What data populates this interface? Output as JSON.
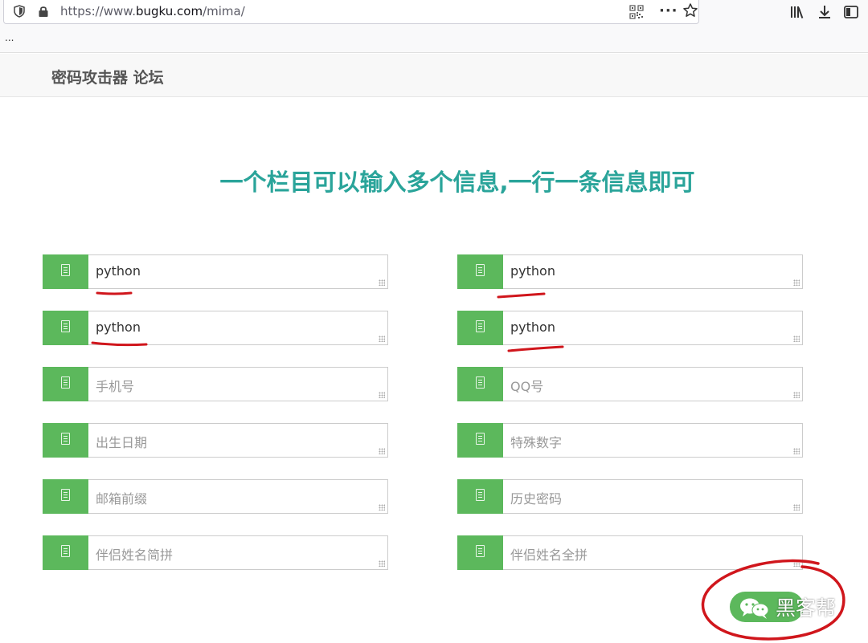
{
  "browser": {
    "url_prefix": "https://www.",
    "url_host": "bugku.com",
    "url_path": "/mima/",
    "more_glyph": "···",
    "bookmarks_overflow": "..."
  },
  "site": {
    "brand": "密码攻击器 论坛"
  },
  "headline": "一个栏目可以输入多个信息,一行一条信息即可",
  "fields": [
    {
      "value": "python",
      "placeholder": ""
    },
    {
      "value": "python",
      "placeholder": ""
    },
    {
      "value": "python",
      "placeholder": ""
    },
    {
      "value": "python",
      "placeholder": ""
    },
    {
      "value": "",
      "placeholder": "手机号"
    },
    {
      "value": "",
      "placeholder": "QQ号"
    },
    {
      "value": "",
      "placeholder": "出生日期"
    },
    {
      "value": "",
      "placeholder": "特殊数字"
    },
    {
      "value": "",
      "placeholder": "邮箱前缀"
    },
    {
      "value": "",
      "placeholder": "历史密码"
    },
    {
      "value": "",
      "placeholder": "伴侣姓名简拼"
    },
    {
      "value": "",
      "placeholder": "伴侣姓名全拼"
    }
  ],
  "watermark": {
    "text": "黑客帮"
  },
  "colors": {
    "accent_green": "#5cb85c",
    "headline_teal": "#2aa49a",
    "annotation_red": "#d0161c"
  }
}
